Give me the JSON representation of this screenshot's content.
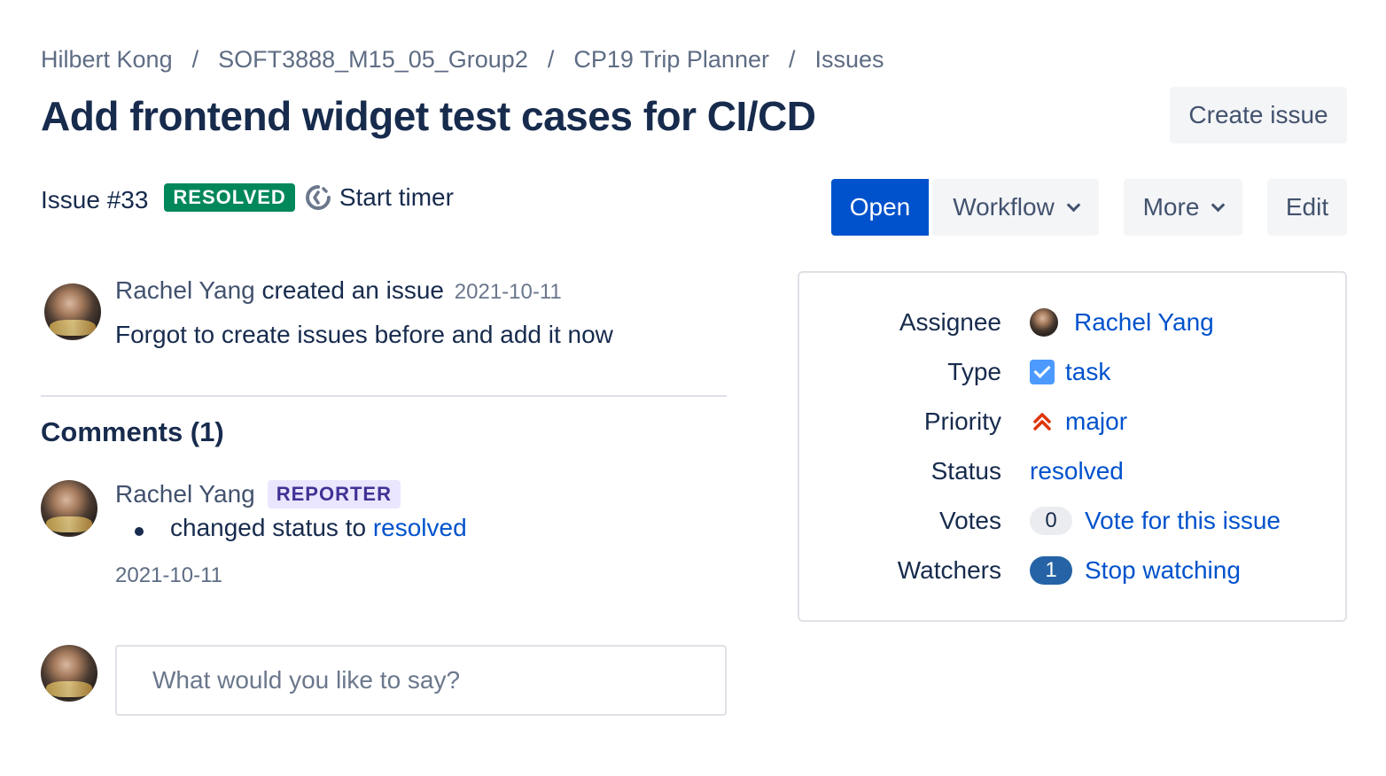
{
  "breadcrumb": {
    "items": [
      "Hilbert Kong",
      "SOFT3888_M15_05_Group2",
      "CP19 Trip Planner",
      "Issues"
    ],
    "separator": "/"
  },
  "issue": {
    "title": "Add frontend widget test cases for CI/CD",
    "number_label": "Issue #33",
    "status_lozenge": "RESOLVED",
    "timer_label": "Start timer"
  },
  "actions": {
    "create_issue": "Create issue",
    "open": "Open",
    "workflow": "Workflow",
    "more": "More",
    "edit": "Edit"
  },
  "activity": {
    "author": "Rachel Yang",
    "action": "created an issue",
    "date": "2021-10-11",
    "description": "Forgot to create issues before and add it now"
  },
  "comments": {
    "heading": "Comments (1)",
    "items": [
      {
        "author": "Rachel Yang",
        "role_badge": "REPORTER",
        "change_text": "changed status to",
        "change_value": "resolved",
        "date": "2021-10-11"
      }
    ],
    "input_placeholder": "What would you like to say?"
  },
  "details": {
    "assignee_label": "Assignee",
    "assignee_value": "Rachel Yang",
    "type_label": "Type",
    "type_value": "task",
    "priority_label": "Priority",
    "priority_value": "major",
    "status_label": "Status",
    "status_value": "resolved",
    "votes_label": "Votes",
    "votes_count": "0",
    "votes_action": "Vote for this issue",
    "watchers_label": "Watchers",
    "watchers_count": "1",
    "watchers_action": "Stop watching"
  },
  "colors": {
    "primary": "#0052cc",
    "resolved": "#00875a",
    "reporter_bg": "#eae6ff",
    "reporter_text": "#403294",
    "priority_major": "#de350b",
    "task": "#4c9aff"
  }
}
